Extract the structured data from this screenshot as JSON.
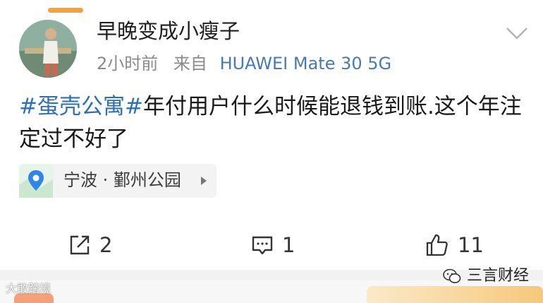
{
  "post": {
    "username": "早晚变成小瘦子",
    "time": "2小时前",
    "source_prefix": "来自",
    "device": "HUAWEI Mate 30 5G",
    "content": {
      "hashtag": "#蛋壳公寓#",
      "text": "年付用户什么时候能退钱到账.这个年注定过不好了"
    },
    "location": "宁波 · 鄞州公园"
  },
  "actions": {
    "repost_count": "2",
    "comment_count": "1",
    "like_count": "11"
  },
  "watermarks": {
    "left": "大敢踏境",
    "right": "三言财经"
  },
  "colors": {
    "hashtag": "#2f6fb2",
    "device": "#4a79ae",
    "tab_indicator": "#f3a33a"
  }
}
